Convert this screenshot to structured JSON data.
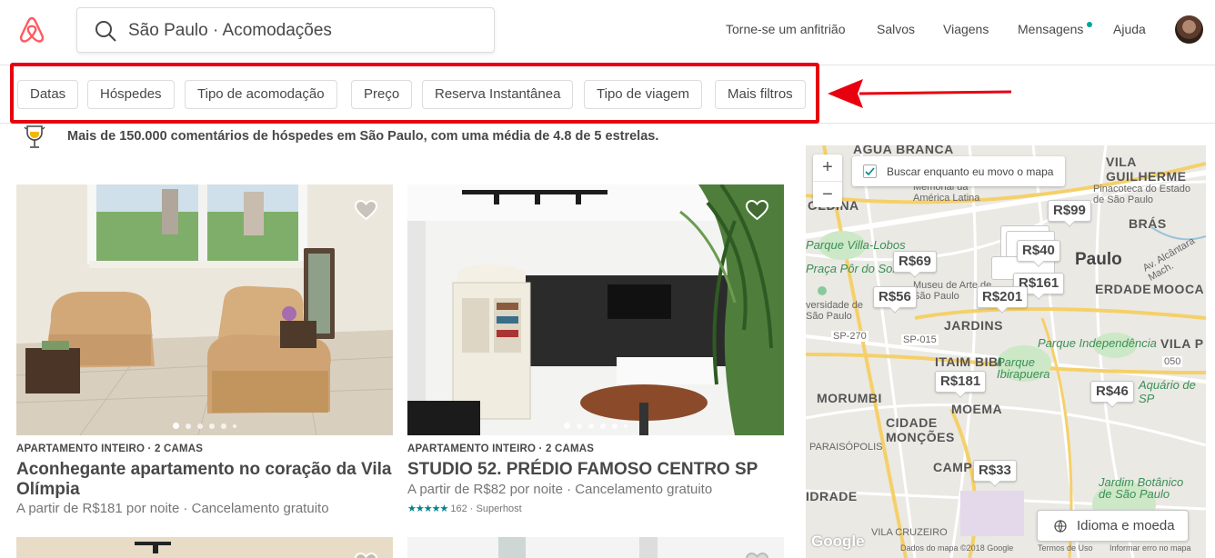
{
  "header": {
    "search_value": "São Paulo · Acomodações",
    "nav": [
      "Torne-se um anfitrião",
      "Salvos",
      "Viagens",
      "Mensagens",
      "Ajuda"
    ]
  },
  "filters": [
    "Datas",
    "Hóspedes",
    "Tipo de acomodação",
    "Preço",
    "Reserva Instantânea",
    "Tipo de viagem",
    "Mais filtros"
  ],
  "banner": {
    "text": "Mais de 150.000 comentários de hóspedes em São Paulo, com uma média de 4.8 de 5 estrelas."
  },
  "listings": [
    {
      "kicker": "APARTAMENTO INTEIRO · 2 CAMAS",
      "title_line1": "Aconhegante apartamento no coração da Vila",
      "title_line2": "Olímpia",
      "price_line": "A partir de R$181 por noite · Cancelamento gratuito"
    },
    {
      "kicker": "APARTAMENTO INTEIRO · 2 CAMAS",
      "title_line1": "STUDIO 52. PRÉDIO FAMOSO CENTRO SP",
      "price_line": "A partir de R$82 por noite · Cancelamento gratuito",
      "stars": "★★★★★",
      "reviews": "162 · Superhost"
    }
  ],
  "map": {
    "search_toggle": "Buscar enquanto eu movo o mapa",
    "language_button": "Idioma e moeda",
    "data_credit": "Dados do mapa ©2018 Google",
    "terms": "Termos de Uso",
    "report": "Informar erro no mapa",
    "google": "Google",
    "markers": [
      "R$99",
      "R$40",
      "R$69",
      "R$161",
      "R$56",
      "R$201",
      "R$181",
      "R$46",
      "R$33"
    ],
    "labels": {
      "agua_branca": "AGUA BRANCA",
      "vila_guilherme": "VILA GUILHERME",
      "bras": "BRÁS",
      "paulo": "Paulo",
      "parque_villa": "Parque Villa-Lobos",
      "praca": "Praça Pôr do Sol",
      "erdade": "ERDADE",
      "mooca": "MOOCA",
      "jardins": "JARDINS",
      "parque_ind": "Parque Independência",
      "vila_p": "VILA P",
      "itaim": "ITAIM BIBI",
      "ibirapuera": "Parque Ibirapuera",
      "morumbi": "MORUMBI",
      "moema": "MOEMA",
      "cidade_moncoes": "CIDADE MONÇÕES",
      "camp": "CAMP",
      "idrade": "IDRADE",
      "jardim_bot": "Jardim Botânico de São Paulo",
      "ldina": "OLDINA",
      "memorial": "Memorial da América Latina",
      "pinacoteca": "Pinacoteca do Estado de São Paulo",
      "museu": "Museu de Arte de São Paulo",
      "universidade": "versidade de São Paulo",
      "aquario": "Aquário de SP",
      "vila_cruzeiro": "VILA CRUZEIRO",
      "paraisopolis": "PARAISÓPOLIS",
      "sp270": "SP-270",
      "sp015": "SP-015",
      "r050": "050",
      "av_alcantara": "Av. Alcântara Mach."
    }
  }
}
